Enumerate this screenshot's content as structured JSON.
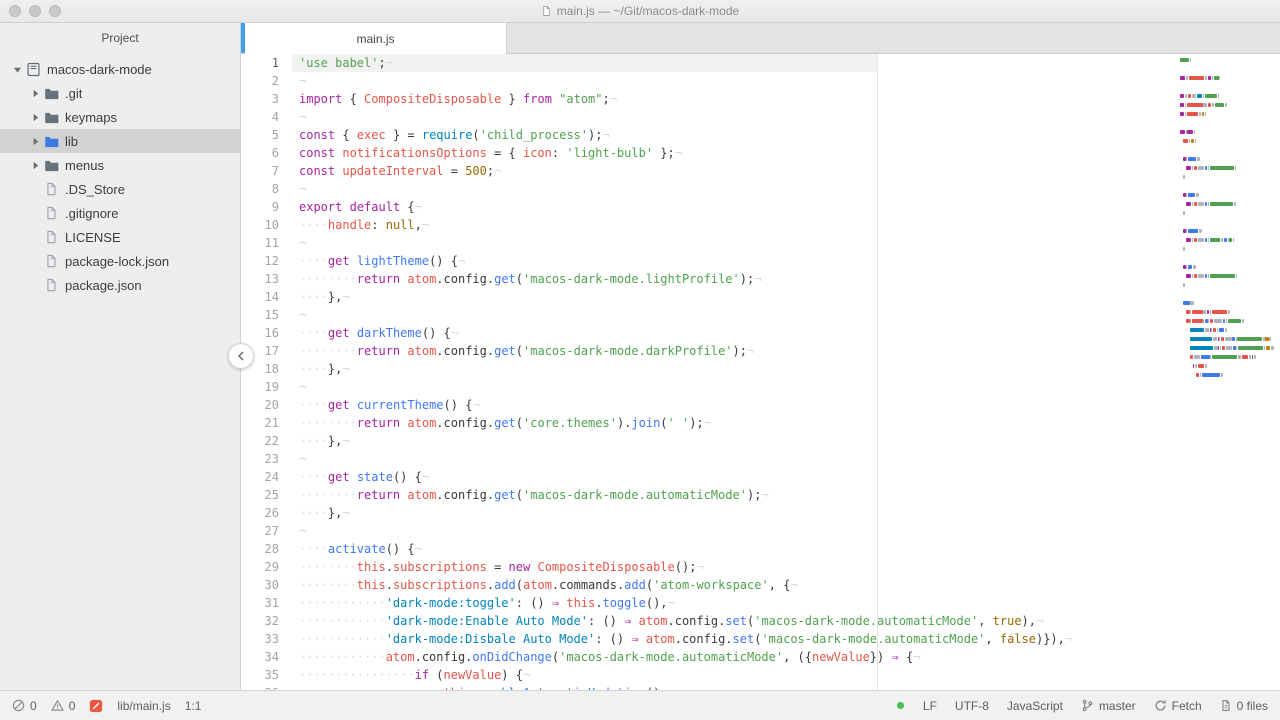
{
  "titlebar": {
    "title": "main.js — ~/Git/macos-dark-mode"
  },
  "sidebar": {
    "header": "Project",
    "tree": [
      {
        "label": "macos-dark-mode",
        "type": "root",
        "depth": 0,
        "expanded": true
      },
      {
        "label": ".git",
        "type": "folder",
        "depth": 1
      },
      {
        "label": "keymaps",
        "type": "folder",
        "depth": 1
      },
      {
        "label": "lib",
        "type": "folder",
        "depth": 1,
        "selected": true
      },
      {
        "label": "menus",
        "type": "folder",
        "depth": 1
      },
      {
        "label": ".DS_Store",
        "type": "file",
        "depth": 1
      },
      {
        "label": ".gitignore",
        "type": "file",
        "depth": 1
      },
      {
        "label": "LICENSE",
        "type": "file",
        "depth": 1
      },
      {
        "label": "package-lock.json",
        "type": "file",
        "depth": 1
      },
      {
        "label": "package.json",
        "type": "file",
        "depth": 1
      }
    ]
  },
  "tabs": [
    {
      "label": "main.js",
      "active": true
    }
  ],
  "editor": {
    "cursor_line": 1,
    "lines": [
      [
        [
          "s",
          "'use babel'"
        ],
        [
          "p",
          ";"
        ],
        [
          "inv",
          "¬"
        ]
      ],
      [
        [
          "inv",
          "¬"
        ]
      ],
      [
        [
          "k",
          "import"
        ],
        [
          "p",
          " { "
        ],
        [
          "v",
          "CompositeDisposable"
        ],
        [
          "p",
          " } "
        ],
        [
          "k",
          "from"
        ],
        [
          "p",
          " "
        ],
        [
          "s",
          "\"atom\""
        ],
        [
          "p",
          ";"
        ],
        [
          "inv",
          "¬"
        ]
      ],
      [
        [
          "inv",
          "¬"
        ]
      ],
      [
        [
          "k",
          "const"
        ],
        [
          "p",
          " { "
        ],
        [
          "v",
          "exec"
        ],
        [
          "p",
          " } = "
        ],
        [
          "sup",
          "require"
        ],
        [
          "p",
          "("
        ],
        [
          "s",
          "'child_process'"
        ],
        [
          "p",
          ");"
        ],
        [
          "inv",
          "¬"
        ]
      ],
      [
        [
          "k",
          "const"
        ],
        [
          "p",
          " "
        ],
        [
          "v",
          "notificationsOptions"
        ],
        [
          "p",
          " = { "
        ],
        [
          "v",
          "icon"
        ],
        [
          "p",
          ": "
        ],
        [
          "s",
          "'light-bulb'"
        ],
        [
          "p",
          " };"
        ],
        [
          "inv",
          "¬"
        ]
      ],
      [
        [
          "k",
          "const"
        ],
        [
          "p",
          " "
        ],
        [
          "v",
          "updateInterval"
        ],
        [
          "p",
          " = "
        ],
        [
          "num",
          "500"
        ],
        [
          "p",
          ";"
        ],
        [
          "inv",
          "¬"
        ]
      ],
      [
        [
          "inv",
          "¬"
        ]
      ],
      [
        [
          "k",
          "export"
        ],
        [
          "p",
          " "
        ],
        [
          "k",
          "default"
        ],
        [
          "p",
          " {"
        ],
        [
          "inv",
          "¬"
        ]
      ],
      [
        [
          "ws",
          "····"
        ],
        [
          "v",
          "handle"
        ],
        [
          "p",
          ": "
        ],
        [
          "num",
          "null"
        ],
        [
          "p",
          ","
        ],
        [
          "inv",
          "¬"
        ]
      ],
      [
        [
          "inv",
          "¬"
        ]
      ],
      [
        [
          "ws",
          "····"
        ],
        [
          "k",
          "get"
        ],
        [
          "p",
          " "
        ],
        [
          "fn",
          "lightTheme"
        ],
        [
          "p",
          "() {"
        ],
        [
          "inv",
          "¬"
        ]
      ],
      [
        [
          "ws",
          "········"
        ],
        [
          "k",
          "return"
        ],
        [
          "p",
          " "
        ],
        [
          "v",
          "atom"
        ],
        [
          "p",
          ".config."
        ],
        [
          "fn",
          "get"
        ],
        [
          "p",
          "("
        ],
        [
          "s",
          "'macos-dark-mode.lightProfile'"
        ],
        [
          "p",
          ");"
        ],
        [
          "inv",
          "¬"
        ]
      ],
      [
        [
          "ws",
          "····"
        ],
        [
          "p",
          "},"
        ],
        [
          "inv",
          "¬"
        ]
      ],
      [
        [
          "inv",
          "¬"
        ]
      ],
      [
        [
          "ws",
          "····"
        ],
        [
          "k",
          "get"
        ],
        [
          "p",
          " "
        ],
        [
          "fn",
          "darkTheme"
        ],
        [
          "p",
          "() {"
        ],
        [
          "inv",
          "¬"
        ]
      ],
      [
        [
          "ws",
          "········"
        ],
        [
          "k",
          "return"
        ],
        [
          "p",
          " "
        ],
        [
          "v",
          "atom"
        ],
        [
          "p",
          ".config."
        ],
        [
          "fn",
          "get"
        ],
        [
          "p",
          "("
        ],
        [
          "s",
          "'macos-dark-mode.darkProfile'"
        ],
        [
          "p",
          ");"
        ],
        [
          "inv",
          "¬"
        ]
      ],
      [
        [
          "ws",
          "····"
        ],
        [
          "p",
          "},"
        ],
        [
          "inv",
          "¬"
        ]
      ],
      [
        [
          "inv",
          "¬"
        ]
      ],
      [
        [
          "ws",
          "····"
        ],
        [
          "k",
          "get"
        ],
        [
          "p",
          " "
        ],
        [
          "fn",
          "currentTheme"
        ],
        [
          "p",
          "() {"
        ],
        [
          "inv",
          "¬"
        ]
      ],
      [
        [
          "ws",
          "········"
        ],
        [
          "k",
          "return"
        ],
        [
          "p",
          " "
        ],
        [
          "v",
          "atom"
        ],
        [
          "p",
          ".config."
        ],
        [
          "fn",
          "get"
        ],
        [
          "p",
          "("
        ],
        [
          "s",
          "'core.themes'"
        ],
        [
          "p",
          ")."
        ],
        [
          "fn",
          "join"
        ],
        [
          "p",
          "("
        ],
        [
          "s",
          "' '"
        ],
        [
          "p",
          ");"
        ],
        [
          "inv",
          "¬"
        ]
      ],
      [
        [
          "ws",
          "····"
        ],
        [
          "p",
          "},"
        ],
        [
          "inv",
          "¬"
        ]
      ],
      [
        [
          "inv",
          "¬"
        ]
      ],
      [
        [
          "ws",
          "····"
        ],
        [
          "k",
          "get"
        ],
        [
          "p",
          " "
        ],
        [
          "fn",
          "state"
        ],
        [
          "p",
          "() {"
        ],
        [
          "inv",
          "¬"
        ]
      ],
      [
        [
          "ws",
          "········"
        ],
        [
          "k",
          "return"
        ],
        [
          "p",
          " "
        ],
        [
          "v",
          "atom"
        ],
        [
          "p",
          ".config."
        ],
        [
          "fn",
          "get"
        ],
        [
          "p",
          "("
        ],
        [
          "s",
          "'macos-dark-mode.automaticMode'"
        ],
        [
          "p",
          ");"
        ],
        [
          "inv",
          "¬"
        ]
      ],
      [
        [
          "ws",
          "····"
        ],
        [
          "p",
          "},"
        ],
        [
          "inv",
          "¬"
        ]
      ],
      [
        [
          "inv",
          "¬"
        ]
      ],
      [
        [
          "ws",
          "····"
        ],
        [
          "fn",
          "activate"
        ],
        [
          "p",
          "() {"
        ],
        [
          "inv",
          "¬"
        ]
      ],
      [
        [
          "ws",
          "········"
        ],
        [
          "v",
          "this"
        ],
        [
          "p",
          "."
        ],
        [
          "v",
          "subscriptions"
        ],
        [
          "p",
          " = "
        ],
        [
          "k",
          "new"
        ],
        [
          "p",
          " "
        ],
        [
          "v",
          "CompositeDisposable"
        ],
        [
          "p",
          "();"
        ],
        [
          "inv",
          "¬"
        ]
      ],
      [
        [
          "ws",
          "········"
        ],
        [
          "v",
          "this"
        ],
        [
          "p",
          "."
        ],
        [
          "v",
          "subscriptions"
        ],
        [
          "p",
          "."
        ],
        [
          "fn",
          "add"
        ],
        [
          "p",
          "("
        ],
        [
          "v",
          "atom"
        ],
        [
          "p",
          ".commands."
        ],
        [
          "fn",
          "add"
        ],
        [
          "p",
          "("
        ],
        [
          "s",
          "'atom-workspace'"
        ],
        [
          "p",
          ", {"
        ],
        [
          "inv",
          "¬"
        ]
      ],
      [
        [
          "ws",
          "············"
        ],
        [
          "key",
          "'dark-mode:toggle'"
        ],
        [
          "p",
          ": () "
        ],
        [
          "k",
          "⇒"
        ],
        [
          "p",
          " "
        ],
        [
          "v",
          "this"
        ],
        [
          "p",
          "."
        ],
        [
          "fn",
          "toggle"
        ],
        [
          "p",
          "(),"
        ],
        [
          "inv",
          "¬"
        ]
      ],
      [
        [
          "ws",
          "············"
        ],
        [
          "key",
          "'dark-mode:Enable Auto Mode'"
        ],
        [
          "p",
          ": () "
        ],
        [
          "k",
          "⇒"
        ],
        [
          "p",
          " "
        ],
        [
          "v",
          "atom"
        ],
        [
          "p",
          ".config."
        ],
        [
          "fn",
          "set"
        ],
        [
          "p",
          "("
        ],
        [
          "s",
          "'macos-dark-mode.automaticMode'"
        ],
        [
          "p",
          ", "
        ],
        [
          "num",
          "true"
        ],
        [
          "p",
          "),"
        ],
        [
          "inv",
          "¬"
        ]
      ],
      [
        [
          "ws",
          "············"
        ],
        [
          "key",
          "'dark-mode:Disbale Auto Mode'"
        ],
        [
          "p",
          ": () "
        ],
        [
          "k",
          "⇒"
        ],
        [
          "p",
          " "
        ],
        [
          "v",
          "atom"
        ],
        [
          "p",
          ".config."
        ],
        [
          "fn",
          "set"
        ],
        [
          "p",
          "("
        ],
        [
          "s",
          "'macos-dark-mode.automaticMode'"
        ],
        [
          "p",
          ", "
        ],
        [
          "num",
          "false"
        ],
        [
          "p",
          ")}),"
        ],
        [
          "inv",
          "¬"
        ]
      ],
      [
        [
          "ws",
          "············"
        ],
        [
          "v",
          "atom"
        ],
        [
          "p",
          ".config."
        ],
        [
          "fn",
          "onDidChange"
        ],
        [
          "p",
          "("
        ],
        [
          "s",
          "'macos-dark-mode.automaticMode'"
        ],
        [
          "p",
          ", ({"
        ],
        [
          "v",
          "newValue"
        ],
        [
          "p",
          "}) "
        ],
        [
          "k",
          "⇒"
        ],
        [
          "p",
          " {"
        ],
        [
          "inv",
          "¬"
        ]
      ],
      [
        [
          "ws",
          "················"
        ],
        [
          "k",
          "if"
        ],
        [
          "p",
          " ("
        ],
        [
          "v",
          "newValue"
        ],
        [
          "p",
          ") {"
        ],
        [
          "inv",
          "¬"
        ]
      ],
      [
        [
          "ws",
          "····················"
        ],
        [
          "v",
          "this"
        ],
        [
          "p",
          "."
        ],
        [
          "fn",
          "enableAutomaticUpdating"
        ],
        [
          "p",
          "();"
        ],
        [
          "inv",
          "¬"
        ]
      ]
    ]
  },
  "statusbar": {
    "left_items": [
      {
        "name": "error-count",
        "icon": "no-errors-icon",
        "label": "0"
      },
      {
        "name": "warning-count",
        "icon": "warnings-icon",
        "label": "0"
      },
      {
        "name": "linter-status",
        "icon": "linter-icon",
        "label": ""
      },
      {
        "name": "file-path",
        "label": "lib/main.js"
      },
      {
        "name": "cursor-position",
        "label": "1:1"
      }
    ],
    "right_items": [
      {
        "name": "status-indicator",
        "icon": "green-dot-icon",
        "label": ""
      },
      {
        "name": "line-ending",
        "label": "LF"
      },
      {
        "name": "encoding",
        "label": "UTF-8"
      },
      {
        "name": "grammar-selector",
        "label": "JavaScript"
      },
      {
        "name": "git-branch",
        "icon": "git-branch-icon",
        "label": "master"
      },
      {
        "name": "git-fetch",
        "icon": "sync-icon",
        "label": "Fetch"
      },
      {
        "name": "git-changed-files",
        "icon": "diff-files-icon",
        "label": "0 files"
      }
    ]
  }
}
